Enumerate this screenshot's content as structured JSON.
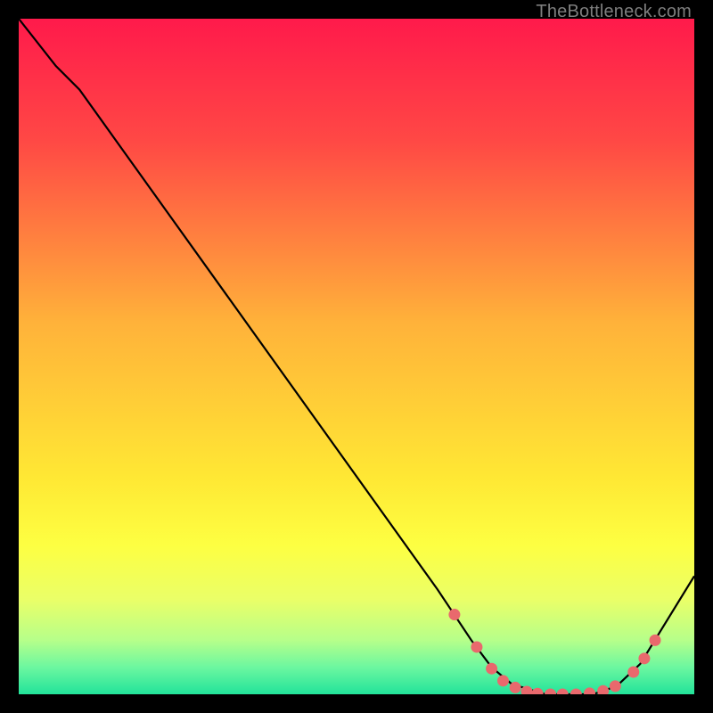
{
  "attribution": "TheBottleneck.com",
  "chart_data": {
    "type": "line",
    "title": "",
    "xlabel": "",
    "ylabel": "",
    "xlim": [
      0,
      100
    ],
    "ylim": [
      0,
      100
    ],
    "gradient_stops": [
      {
        "pct": 0,
        "color": "#ff1a4b"
      },
      {
        "pct": 18,
        "color": "#ff4845"
      },
      {
        "pct": 45,
        "color": "#ffb23a"
      },
      {
        "pct": 68,
        "color": "#ffe834"
      },
      {
        "pct": 78,
        "color": "#fdff42"
      },
      {
        "pct": 86,
        "color": "#eaff68"
      },
      {
        "pct": 92,
        "color": "#b6ff8a"
      },
      {
        "pct": 96,
        "color": "#6cf7a0"
      },
      {
        "pct": 100,
        "color": "#22e39a"
      }
    ],
    "curve": [
      {
        "x": 0.0,
        "y": 100.0
      },
      {
        "x": 5.5,
        "y": 93.0
      },
      {
        "x": 9.0,
        "y": 89.5
      },
      {
        "x": 62.0,
        "y": 15.5
      },
      {
        "x": 67.0,
        "y": 8.0
      },
      {
        "x": 70.0,
        "y": 4.0
      },
      {
        "x": 73.0,
        "y": 1.5
      },
      {
        "x": 78.0,
        "y": 0.0
      },
      {
        "x": 85.0,
        "y": 0.0
      },
      {
        "x": 88.5,
        "y": 1.2
      },
      {
        "x": 92.0,
        "y": 4.5
      },
      {
        "x": 100.0,
        "y": 17.5
      }
    ],
    "markers": [
      {
        "x": 64.5,
        "y": 11.8
      },
      {
        "x": 67.8,
        "y": 7.0
      },
      {
        "x": 70.0,
        "y": 3.8
      },
      {
        "x": 71.7,
        "y": 2.0
      },
      {
        "x": 73.5,
        "y": 1.0
      },
      {
        "x": 75.2,
        "y": 0.4
      },
      {
        "x": 76.8,
        "y": 0.1
      },
      {
        "x": 78.7,
        "y": 0.0
      },
      {
        "x": 80.5,
        "y": 0.0
      },
      {
        "x": 82.5,
        "y": 0.0
      },
      {
        "x": 84.5,
        "y": 0.15
      },
      {
        "x": 86.5,
        "y": 0.5
      },
      {
        "x": 88.3,
        "y": 1.2
      },
      {
        "x": 91.0,
        "y": 3.3
      },
      {
        "x": 92.6,
        "y": 5.3
      },
      {
        "x": 94.2,
        "y": 8.0
      }
    ],
    "marker_color": "#e9696d",
    "curve_color": "#000000"
  }
}
